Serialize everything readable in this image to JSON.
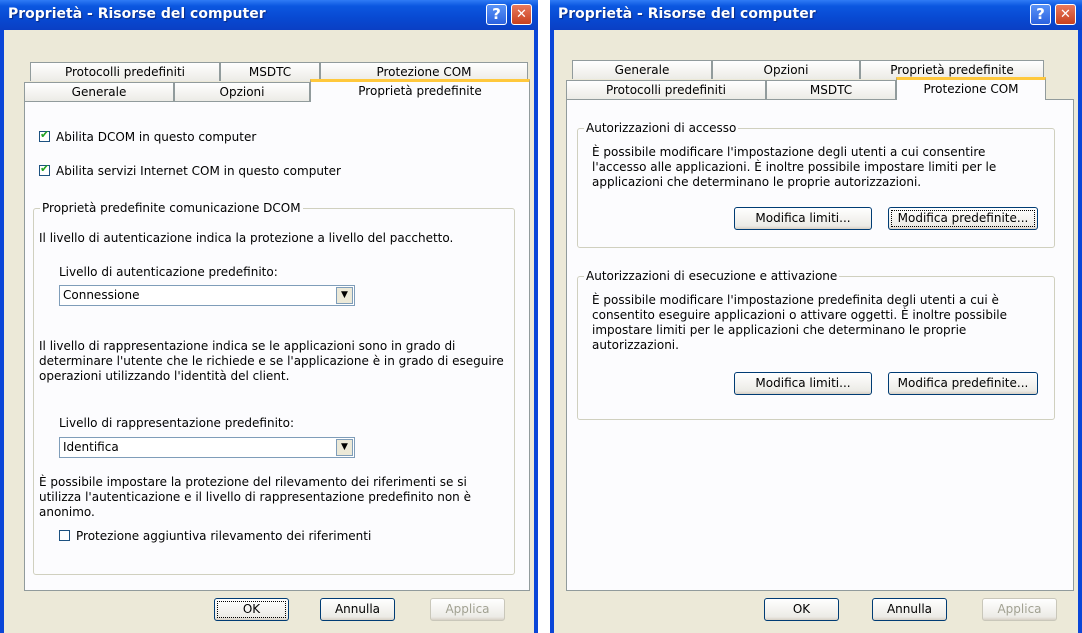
{
  "left_dialog": {
    "title": "Proprietà - Risorse del computer",
    "help_label": "?",
    "close_label": "✕",
    "tabs_back": [
      "Protocolli predefiniti",
      "MSDTC",
      "Protezione COM"
    ],
    "tabs_front": [
      "Generale",
      "Opzioni",
      "Proprietà predefinite"
    ],
    "enable_dcom_label": "Abilita DCOM in questo computer",
    "enable_dcom_checked": true,
    "enable_internet_com_label": "Abilita servizi Internet COM in questo computer",
    "enable_internet_com_checked": true,
    "group_title": "Proprietà predefinite comunicazione DCOM",
    "auth_description": "Il livello di autenticazione indica la protezione a livello del pacchetto.",
    "auth_level_label": "Livello di autenticazione predefinito:",
    "auth_level_value": "Connessione",
    "impersonation_description": "Il livello di rappresentazione indica se le applicazioni sono in grado di determinare l'utente che le richiede e se l'applicazione è in grado di eseguire operazioni utilizzando l'identità del client.",
    "impersonation_level_label": "Livello di rappresentazione predefinito:",
    "impersonation_level_value": "Identifica",
    "reference_tracking_description": "È possibile impostare la protezione del rilevamento dei riferimenti se si utilizza l'autenticazione e il livello di rappresentazione predefinito non è anonimo.",
    "reference_tracking_label": "Protezione aggiuntiva rilevamento dei riferimenti",
    "reference_tracking_checked": false,
    "ok_label": "OK",
    "cancel_label": "Annulla",
    "apply_label": "Applica"
  },
  "right_dialog": {
    "title": "Proprietà - Risorse del computer",
    "help_label": "?",
    "close_label": "✕",
    "tabs_back": [
      "Generale",
      "Opzioni",
      "Proprietà predefinite"
    ],
    "tabs_front": [
      "Protocolli predefiniti",
      "MSDTC",
      "Protezione COM"
    ],
    "access_group_title": "Autorizzazioni di accesso",
    "access_description": "È possibile modificare l'impostazione degli utenti a cui consentire l'accesso alle applicazioni. È inoltre possibile impostare limiti per le applicazioni che determinano le proprie autorizzazioni.",
    "access_edit_limits": "Modifica limiti...",
    "access_edit_default": "Modifica predefinite...",
    "launch_group_title": "Autorizzazioni di esecuzione e attivazione",
    "launch_description": "È possibile modificare l'impostazione predefinita degli utenti a cui è consentito eseguire applicazioni o attivare oggetti. È inoltre possibile impostare limiti per le applicazioni che determinano le proprie autorizzazioni.",
    "launch_edit_limits": "Modifica limiti...",
    "launch_edit_default": "Modifica predefinite...",
    "ok_label": "OK",
    "cancel_label": "Annulla",
    "apply_label": "Applica"
  },
  "colors": {
    "titlebar": "#0a4bd8",
    "window_face": "#ece9d8",
    "tab_highlight": "#ffc83c",
    "annotation_arrow": "#ff0000"
  }
}
